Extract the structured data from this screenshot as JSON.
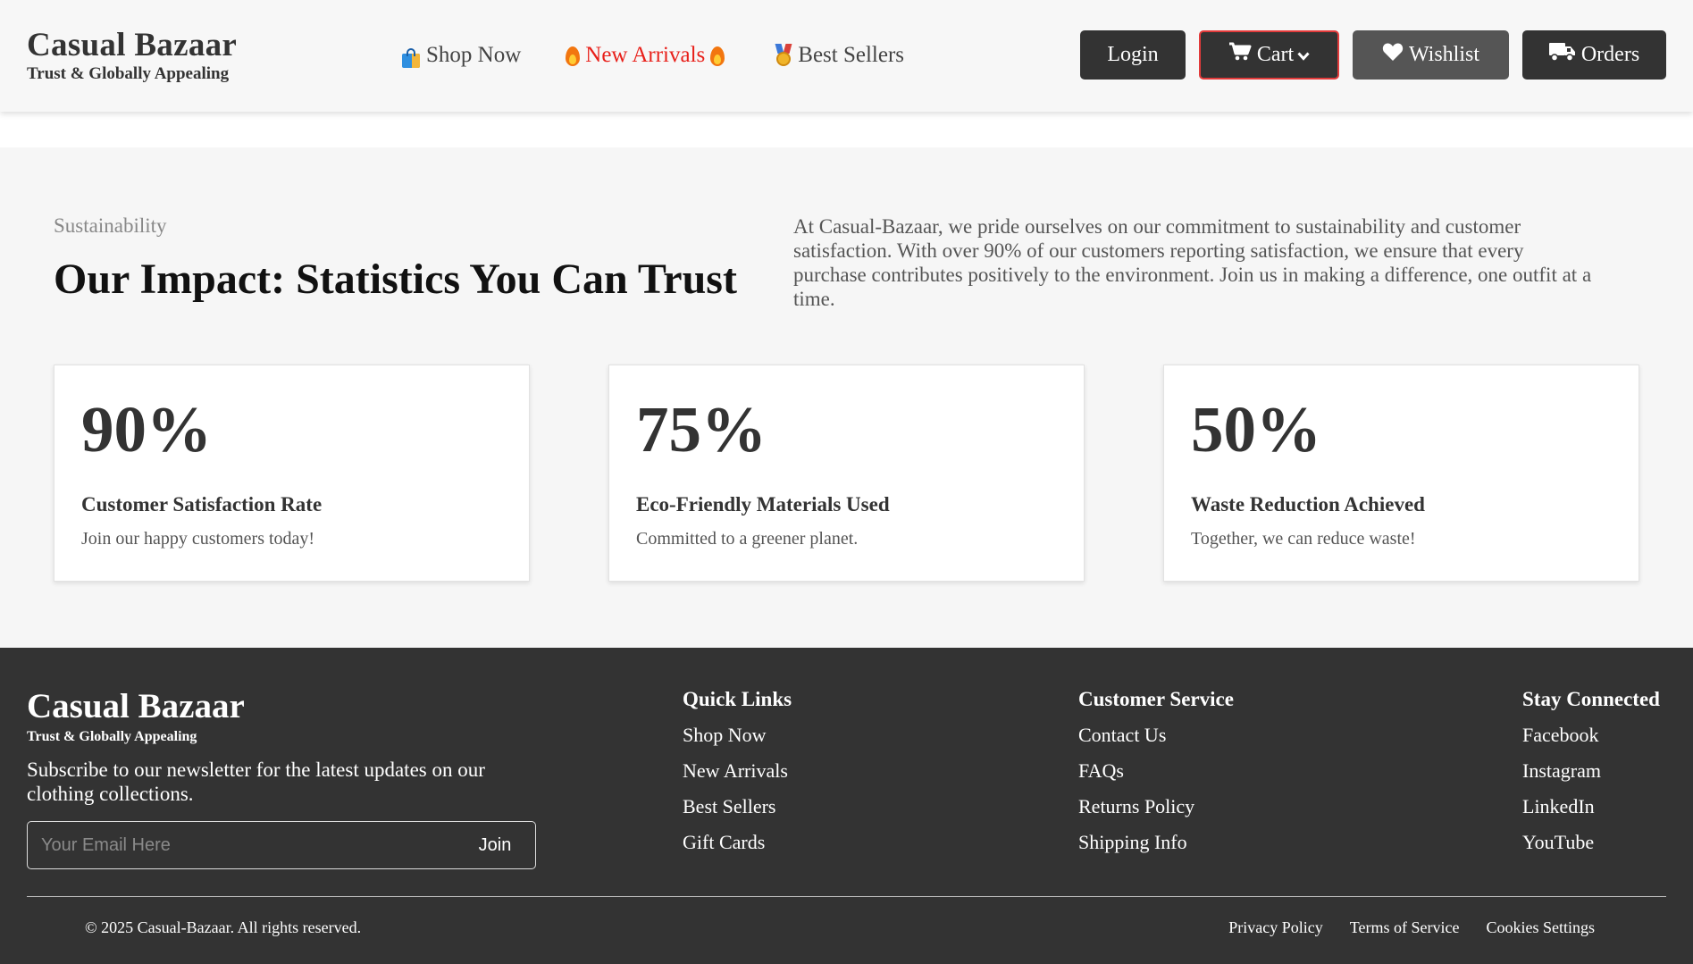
{
  "header": {
    "brand_name": "Casual Bazaar",
    "brand_tagline": "Trust & Globally Appealing",
    "nav": {
      "shop_now": "Shop Now",
      "new_arrivals": "New Arrivals",
      "best_sellers": "Best Sellers"
    },
    "buttons": {
      "login": "Login",
      "cart": "Cart",
      "wishlist": "Wishlist",
      "orders": "Orders"
    },
    "colors": {
      "new_arrivals": "#e8201a",
      "cart_border": "#e23b3b",
      "button_dark": "#333333",
      "wishlist_button": "#555555"
    }
  },
  "stats": {
    "eyebrow": "Sustainability",
    "title": "Our Impact: Statistics You Can Trust",
    "description": "At Casual-Bazaar, we pride ourselves on our commitment to sustainability and customer satisfaction. With over 90% of our customers reporting satisfaction, we ensure that every purchase contributes positively to the environment. Join us in making a difference, one outfit at a time.",
    "cards": [
      {
        "value": "90%",
        "label": "Customer Satisfaction Rate",
        "sub": "Join our happy customers today!"
      },
      {
        "value": "75%",
        "label": "Eco-Friendly Materials Used",
        "sub": "Committed to a greener planet."
      },
      {
        "value": "50%",
        "label": "Waste Reduction Achieved",
        "sub": "Together, we can reduce waste!"
      }
    ]
  },
  "footer": {
    "brand_name": "Casual Bazaar",
    "brand_tagline": "Trust & Globally Appealing",
    "newsletter_text": "Subscribe to our newsletter for the latest updates on our clothing collections.",
    "email_placeholder": "Your Email Here",
    "join_label": "Join",
    "quick_links": {
      "title": "Quick Links",
      "items": [
        "Shop Now",
        "New Arrivals",
        "Best Sellers",
        "Gift Cards"
      ]
    },
    "customer_service": {
      "title": "Customer Service",
      "items": [
        "Contact Us",
        "FAQs",
        "Returns Policy",
        "Shipping Info"
      ]
    },
    "stay_connected": {
      "title": "Stay Connected",
      "items": [
        "Facebook",
        "Instagram",
        "LinkedIn",
        "YouTube"
      ]
    },
    "copyright": "© 2025 Casual-Bazaar. All rights reserved.",
    "bottom_links": [
      "Privacy Policy",
      "Terms of Service",
      "Cookies Settings"
    ]
  },
  "icons": {
    "shop_now": "shopping-bag-icon",
    "new_arrivals": "fire-icon",
    "best_sellers": "medal-icon",
    "cart": "cart-icon",
    "cart_dropdown": "chevron-down-icon",
    "wishlist": "heart-icon",
    "orders": "truck-icon"
  }
}
